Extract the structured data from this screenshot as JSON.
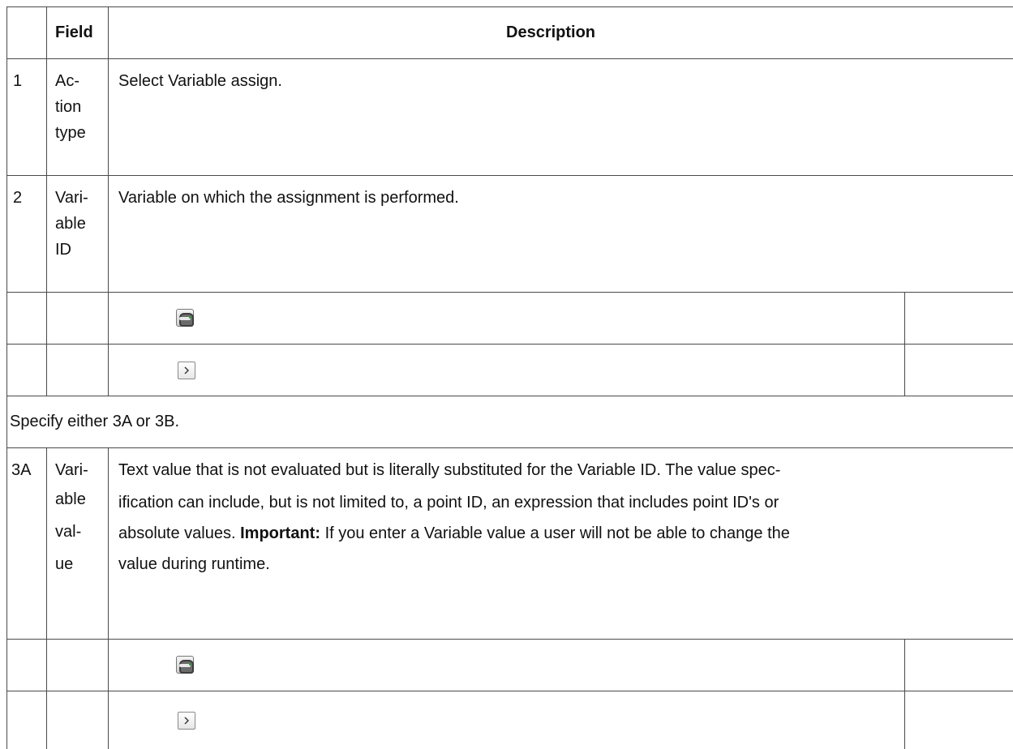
{
  "header": {
    "col_index": "",
    "col_field": "Field",
    "col_description": "Description"
  },
  "rows": [
    {
      "index": "1",
      "field_lines": [
        "Ac-",
        "tion",
        "type"
      ],
      "description": "Select Variable assign."
    },
    {
      "index": "2",
      "field_lines": [
        "Vari-",
        "able",
        "ID"
      ],
      "description": "Variable on which the assignment is performed."
    }
  ],
  "note": "Specify either 3A or 3B.",
  "row3a": {
    "index": "3A",
    "field_lines": [
      "Vari-",
      "able",
      "val-",
      "ue"
    ],
    "description_lines": [
      "Text value that is not evaluated but is literally substituted for the Variable ID. The value spec-",
      "ification can include, but is not limited to, a point ID, an expression that includes point ID's or",
      "absolute values.",
      "If you enter a Variable value a user will not be able to change the",
      "value during runtime."
    ],
    "important_label": "Important:"
  },
  "icons": {
    "browse": "database-browse-icon",
    "expand": "expand-arrow-icon"
  }
}
